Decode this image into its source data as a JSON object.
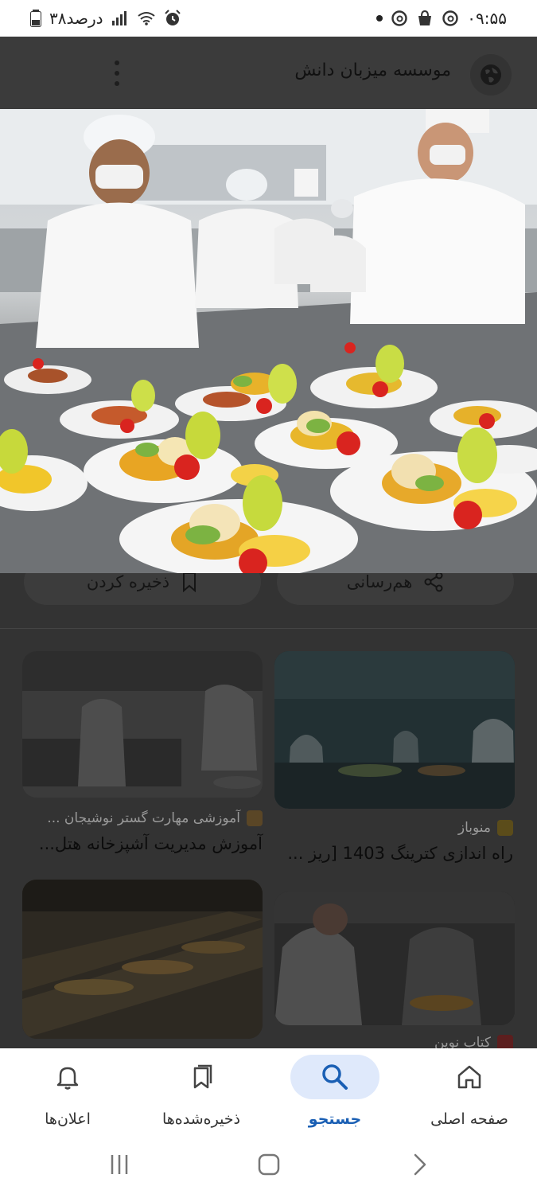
{
  "status_bar": {
    "time": "۰۹:۵۵",
    "battery": "۳۸درصد"
  },
  "header": {
    "site_title": "موسسه میزبان دانش"
  },
  "actions": {
    "share_label": "هم‌رسانی",
    "save_label": "ذخیره کردن"
  },
  "results": [
    {
      "source": "منوباز",
      "title": "راه اندازی کترینگ 1403 [ریز ...",
      "favicon_color": "#f2c10f"
    },
    {
      "source": "آموزشی مهارت گستر نوشیجان ...",
      "title": "آموزش مدیریت آشپزخانه هتل...",
      "favicon_color": "#d9a441"
    },
    {
      "source": "کتاب نوین",
      "title": "",
      "favicon_color": "#d23a3a"
    }
  ],
  "bottom_nav": {
    "items": [
      {
        "label": "صفحه اصلی",
        "icon": "home-icon"
      },
      {
        "label": "جستجو",
        "icon": "search-icon",
        "active": true
      },
      {
        "label": "ذخیره‌شده‌ها",
        "icon": "bookmarks-icon"
      },
      {
        "label": "اعلان‌ها",
        "icon": "bell-icon"
      }
    ]
  },
  "colors": {
    "accent": "#1a5fb4",
    "active_pill": "#dfe9fb",
    "scrim": "#333333"
  }
}
